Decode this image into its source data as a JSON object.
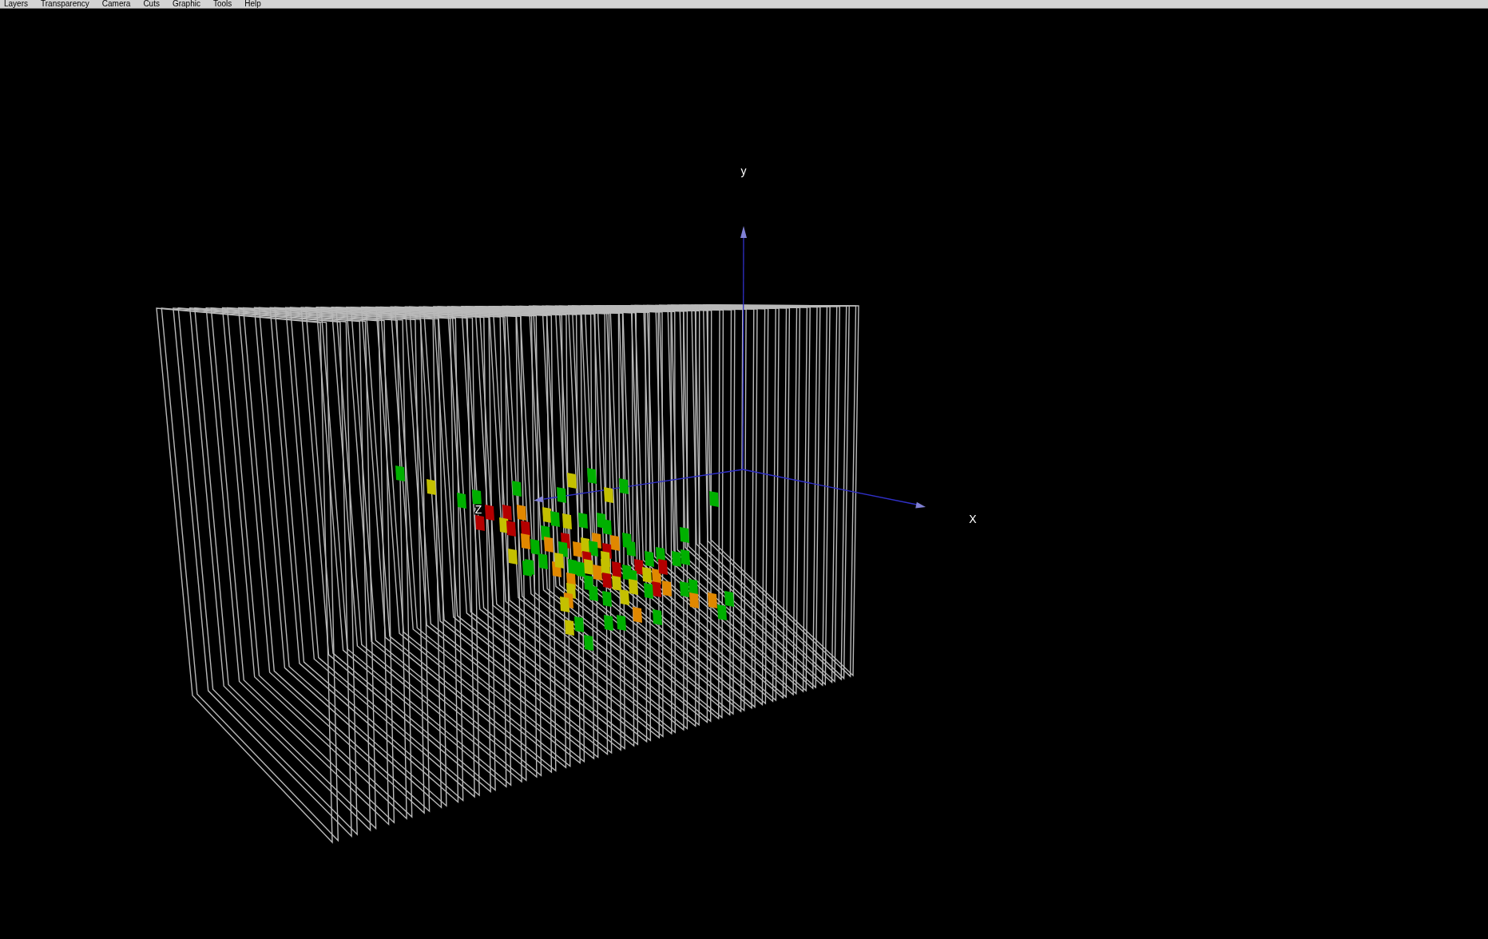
{
  "menu_bar": {
    "items": [
      "Layers",
      "Transparency",
      "Camera",
      "Cuts",
      "Graphic",
      "Tools",
      "Help"
    ]
  },
  "viewer": {
    "axes": [
      {
        "kind": "y",
        "label": "y"
      },
      {
        "kind": "x",
        "label": "X"
      },
      {
        "kind": "z",
        "label": "Z"
      }
    ]
  }
}
